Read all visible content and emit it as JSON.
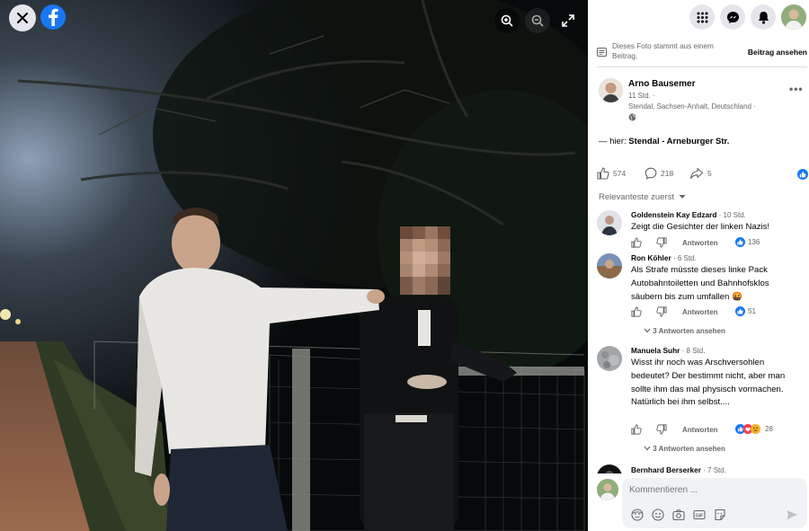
{
  "notice": {
    "text": "Dieses Foto stammt aus einem Beitrag.",
    "link": "Beitrag ansehen"
  },
  "post": {
    "author": "Arno Bausemer",
    "time": "11 Std. ·",
    "location": "Stendal, Sachsen-Anhalt, Deutschland ·",
    "text_prefix": "— hier: ",
    "text_place": "Stendal - Arneburger Str."
  },
  "stats": {
    "likes": "574",
    "comments": "218",
    "shares": "5"
  },
  "sort_label": "Relevanteste zuerst",
  "reply_label": "Antworten",
  "comments": [
    {
      "author": "Goldenstein Kay Edzard",
      "time": " · 10 Std.",
      "text": "Zeigt die Gesichter der linken Nazis!",
      "reactions": "136"
    },
    {
      "author": "Ron Köhler",
      "time": " · 6 Std.",
      "text": "Als Strafe müsste dieses linke Pack Autobahntoiletten und Bahnhofsklos säubern bis zum umfallen 🤬",
      "reactions": "51",
      "replies": "3 Antworten ansehen"
    },
    {
      "author": "Manuela Suhr",
      "time": " · 8 Std.",
      "text": "Wisst ihr noch was Arschversohlen bedeutet? Der bestimmt nicht, aber man sollte ihm das mal physisch vormachen. Natürlich bei ihm selbst....",
      "reactions": "28",
      "replies": "3 Antworten ansehen"
    },
    {
      "author": "Bernhard Berserker",
      "time": " · 7 Std."
    }
  ],
  "compose": {
    "placeholder": "Kommentieren ..."
  },
  "colors": {
    "brand": "#1877f2",
    "panel_bg": "#ffffff",
    "secondary_text": "#65676b",
    "button_bg": "#e4e6eb",
    "input_bg": "#f0f2f5"
  }
}
